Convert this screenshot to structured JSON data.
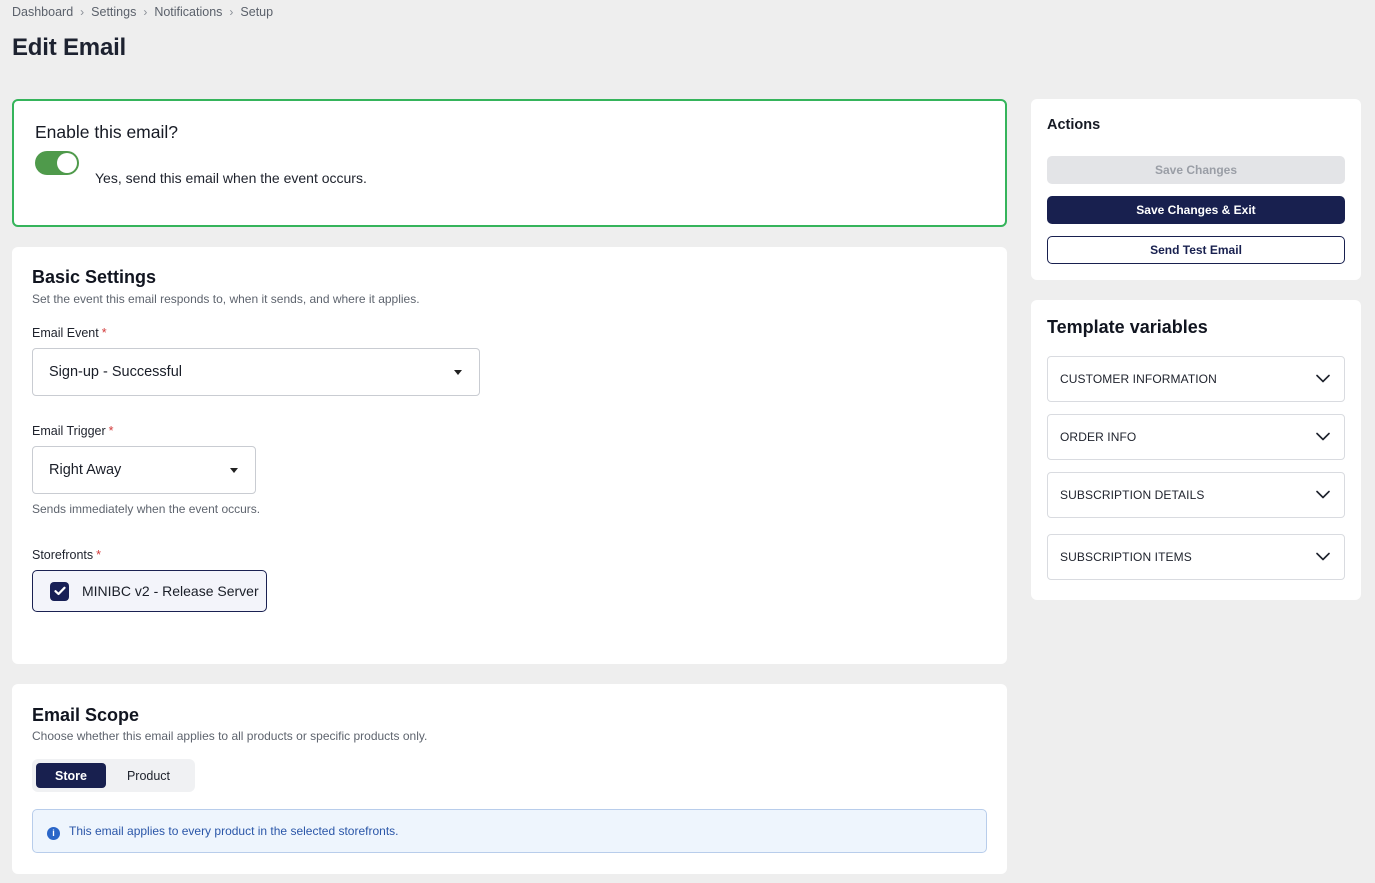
{
  "breadcrumb": [
    "Dashboard",
    "Settings",
    "Notifications",
    "Setup"
  ],
  "page_title": "Edit Email",
  "enable": {
    "title": "Enable this email?",
    "toggle_on": true,
    "description": "Yes, send this email when the event occurs."
  },
  "basic": {
    "title": "Basic Settings",
    "subtitle": "Set the event this email responds to, when it sends, and where it applies.",
    "email_event": {
      "label": "Email Event",
      "required": "*",
      "value": "Sign-up - Successful"
    },
    "email_trigger": {
      "label": "Email Trigger",
      "required": "*",
      "value": "Right Away",
      "helper": "Sends immediately when the event occurs."
    },
    "storefronts": {
      "label": "Storefronts",
      "required": "*",
      "item": "MINIBC v2 - Release Server",
      "checked": true
    }
  },
  "scope": {
    "title": "Email Scope",
    "subtitle": "Choose whether this email applies to all products or specific products only.",
    "options": [
      "Store",
      "Product"
    ],
    "selected": "Store",
    "info_icon": "info-icon",
    "info": "This email applies to every product in the selected storefronts."
  },
  "actions": {
    "title": "Actions",
    "save": "Save Changes",
    "save_exit": "Save Changes & Exit",
    "send_test": "Send Test Email"
  },
  "template_vars": {
    "title": "Template variables",
    "items": [
      "CUSTOMER INFORMATION",
      "ORDER INFO",
      "SUBSCRIPTION DETAILS",
      "SUBSCRIPTION ITEMS"
    ]
  },
  "colors": {
    "primary": "#18204f",
    "success_border": "#35b45b",
    "toggle": "#4f9a4b",
    "info_text": "#2a56a8"
  }
}
